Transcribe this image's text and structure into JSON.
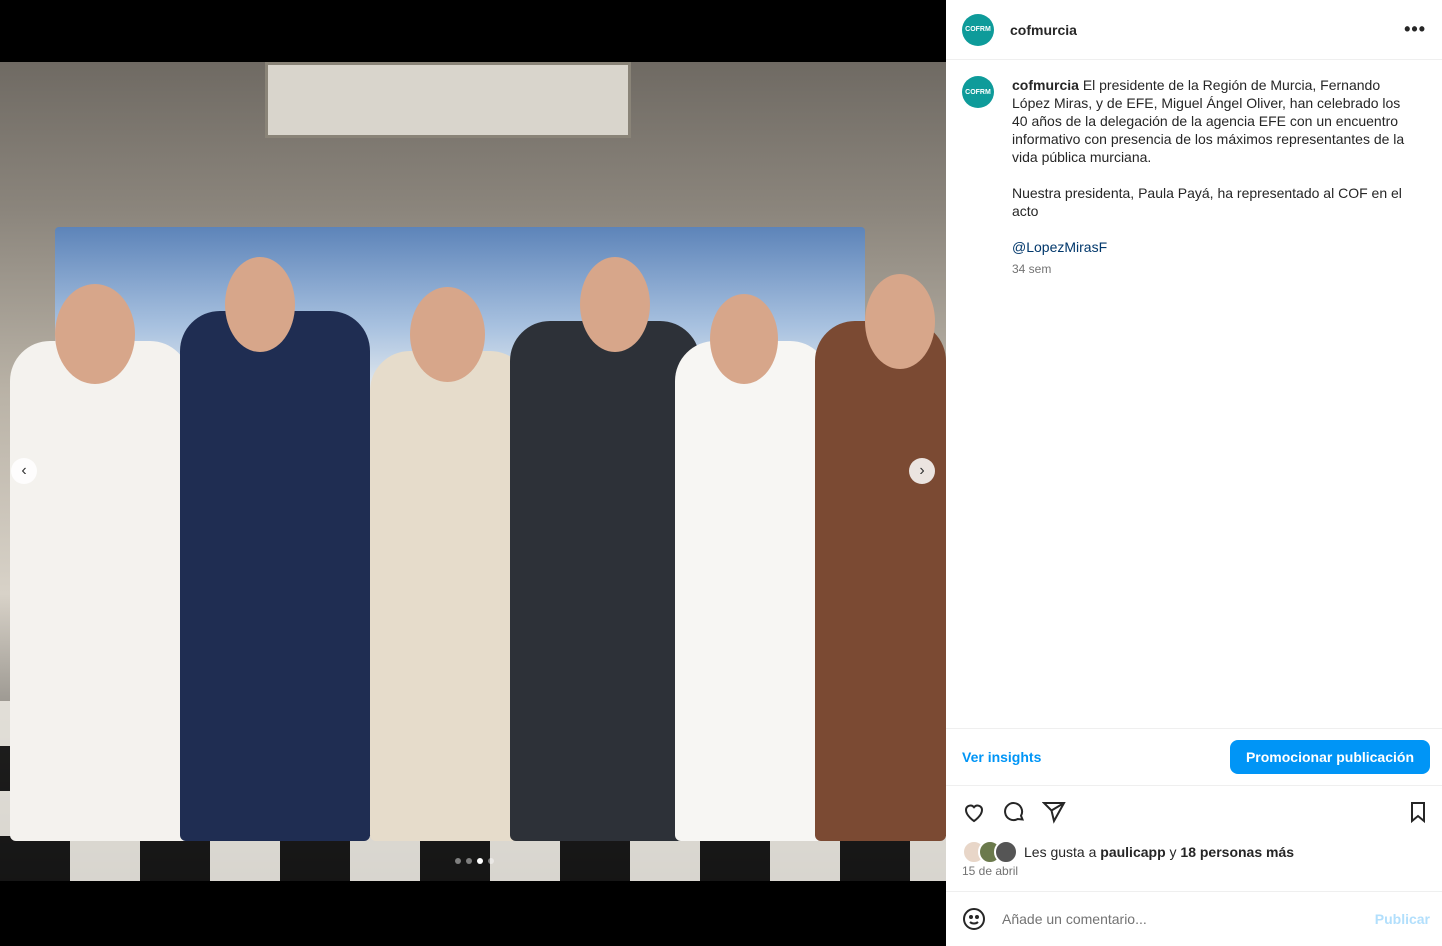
{
  "post": {
    "username": "cofmurcia",
    "avatar_text": "COFRM",
    "more_icon": "more-horizontal-icon",
    "caption": {
      "author": "cofmurcia",
      "paragraph1": "El presidente de la Región de Murcia, Fernando López Miras, y de EFE, Miguel Ángel Oliver, han celebrado los 40 años de la delegación de la agencia EFE con un encuentro informativo con presencia de los máximos representantes de la vida pública murciana.",
      "paragraph2": "Nuestra presidenta, Paula Payá, ha representado al COF en el acto",
      "mention": "@LopezMirasF",
      "time": "34 sem"
    },
    "insights_label": "Ver insights",
    "promote_label": "Promocionar publicación",
    "likes": {
      "prefix": "Les gusta a ",
      "user": "paulicapp",
      "middle": " y ",
      "others": "18 personas más"
    },
    "date": "15 de abril",
    "comment_placeholder": "Añade un comentario...",
    "publish_label": "Publicar"
  },
  "carousel": {
    "slides": 4,
    "active_slide": 3
  },
  "colors": {
    "brand_teal": "#0e9b9a",
    "link_blue": "#0095f6",
    "mention_blue": "#00376b"
  }
}
